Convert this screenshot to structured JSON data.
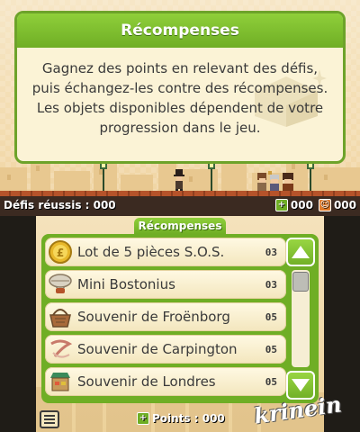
{
  "top": {
    "dialog_title": "Récompenses",
    "dialog_text": "Gagnez des points en relevant des défis,\npuis échangez-les contre des récompenses.\nLes objets disponibles dépendent de votre\nprogression dans le jeu.",
    "hud_label": "Défis réussis : 000",
    "green_count": "000",
    "orange_count": "000"
  },
  "bottom": {
    "panel_title": "Récompenses",
    "items": [
      {
        "name": "Lot de 5 pièces S.O.S.",
        "count": "03",
        "icon": "coin-icon"
      },
      {
        "name": "Mini Bostonius",
        "count": "03",
        "icon": "airship-icon"
      },
      {
        "name": "Souvenir de Froënborg",
        "count": "05",
        "icon": "basket-icon"
      },
      {
        "name": "Souvenir de Carpington",
        "count": "05",
        "icon": "ribbon-icon"
      },
      {
        "name": "Souvenir de Londres",
        "count": "05",
        "icon": "market-stall-icon"
      }
    ],
    "points_label": "Points : 000",
    "watermark": "krinein"
  },
  "colors": {
    "accent_green": "#6fae25",
    "background": "#f3dcb0"
  }
}
